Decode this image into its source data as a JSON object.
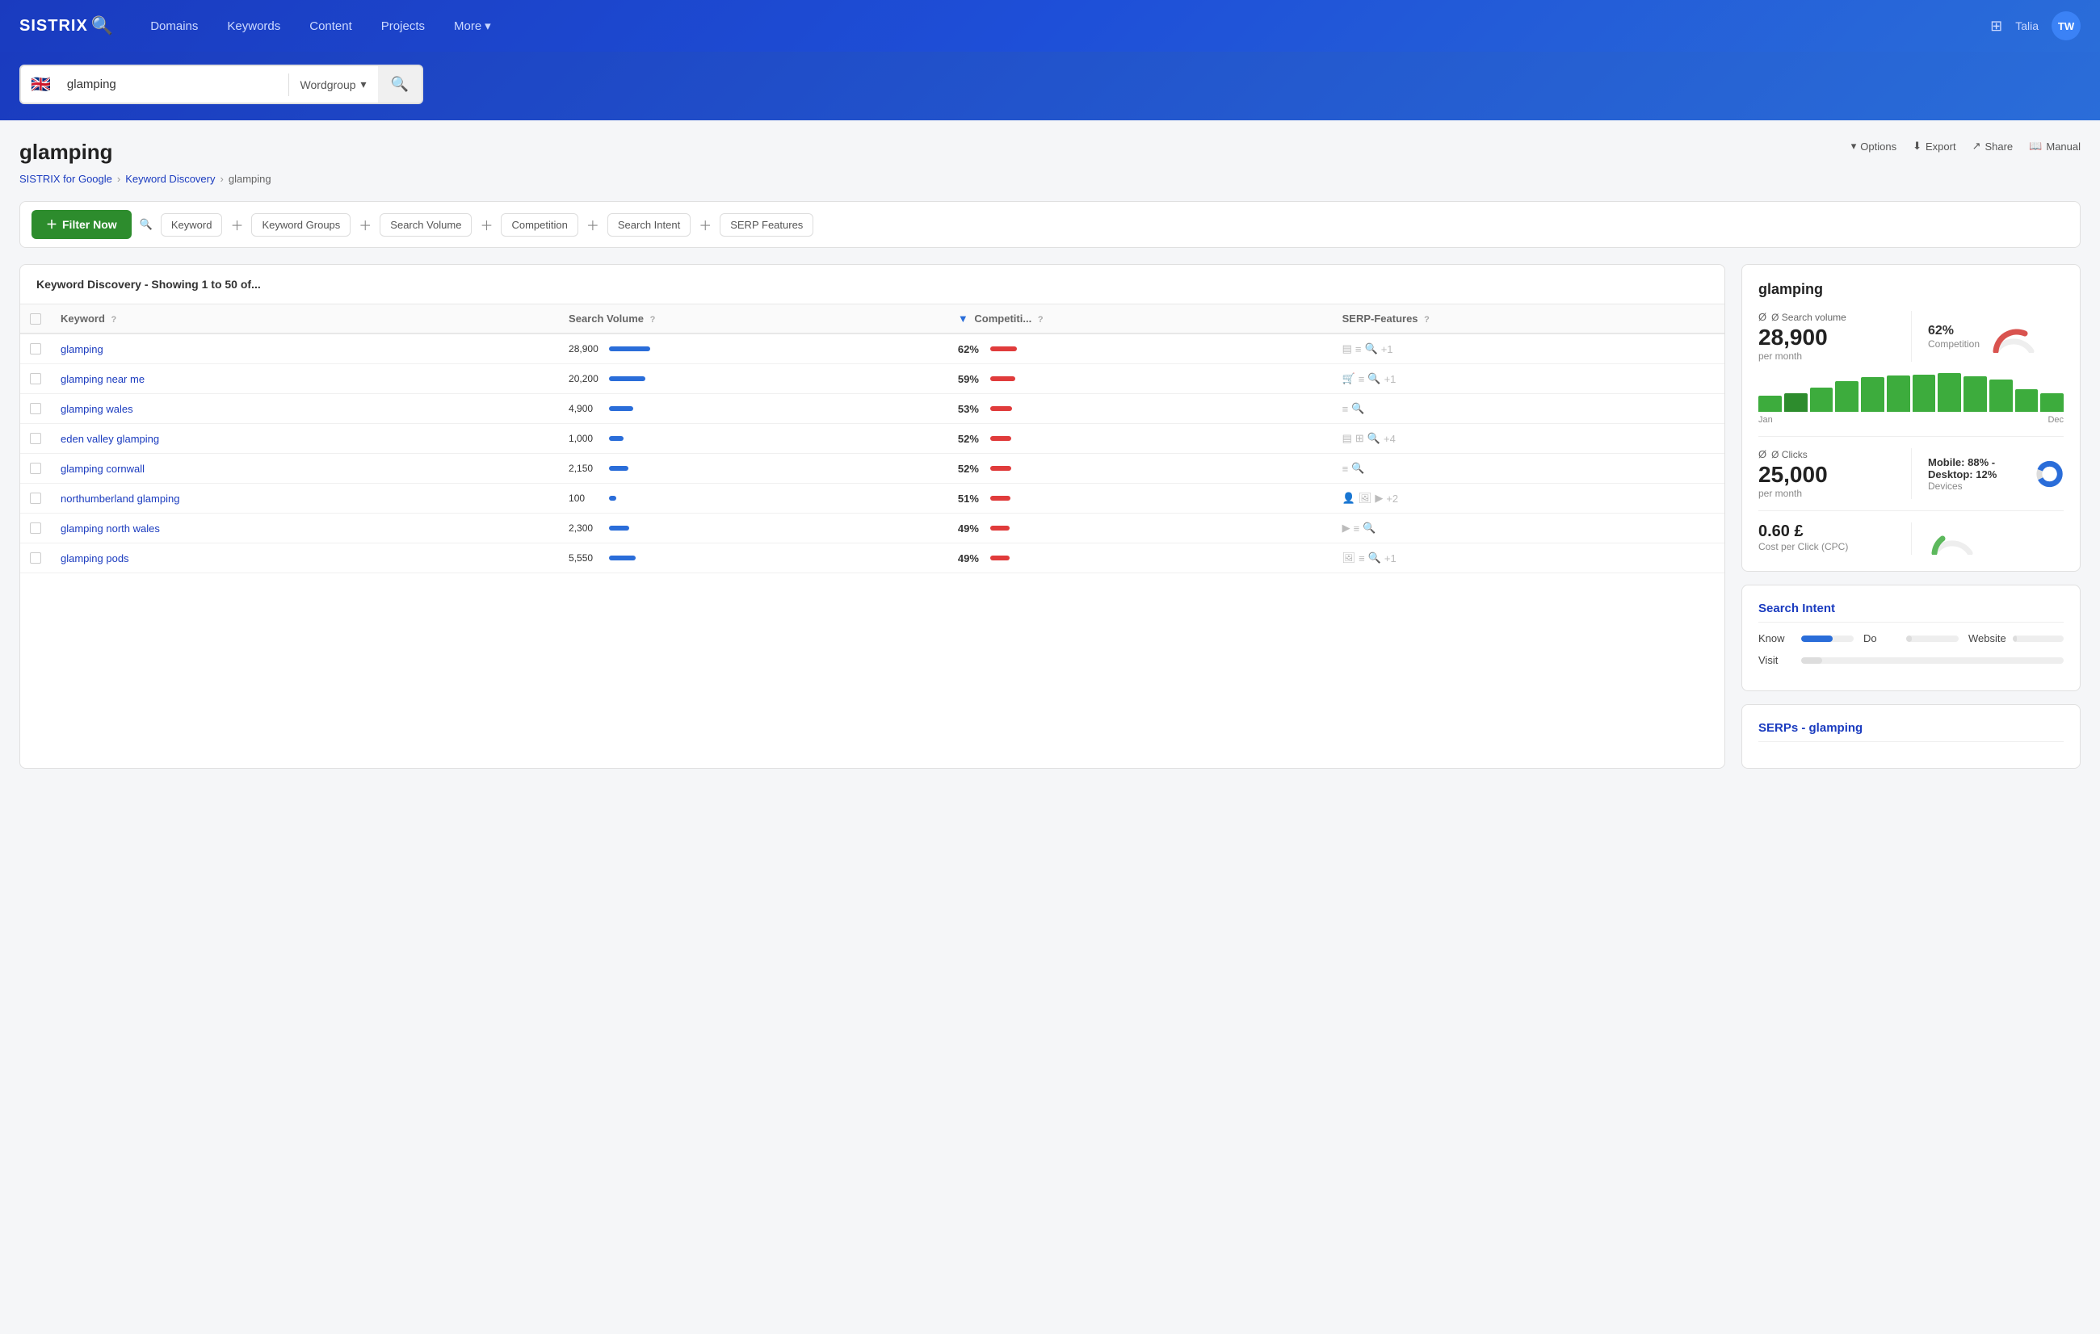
{
  "brand": {
    "name": "SISTRIX",
    "icon": "🔍"
  },
  "navbar": {
    "links": [
      "Domains",
      "Keywords",
      "Content",
      "Projects"
    ],
    "more": "More",
    "user_name": "Talia",
    "user_initials": "TW"
  },
  "search": {
    "query": "glamping",
    "filter": "Wordgroup",
    "flag": "🇬🇧",
    "placeholder": "glamping"
  },
  "page": {
    "title": "glamping",
    "breadcrumb_root": "SISTRIX for Google",
    "breadcrumb_mid": "Keyword Discovery",
    "breadcrumb_current": "glamping",
    "actions": [
      "Options",
      "Export",
      "Share",
      "Manual"
    ]
  },
  "filters": {
    "filter_btn": "Filter Now",
    "items": [
      "Keyword",
      "Keyword Groups",
      "Search Volume",
      "Competition",
      "Search Intent",
      "SERP Features"
    ]
  },
  "table": {
    "header": "Keyword Discovery - Showing 1 to 50 of...",
    "columns": [
      "Keyword",
      "Search Volume",
      "Competiti...",
      "SERP-Features"
    ],
    "rows": [
      {
        "keyword": "glamping",
        "volume": 28900,
        "vol_bar": 85,
        "competition": 62,
        "comp_bar": 60,
        "serp": [
          "▤",
          "≡",
          "🔍",
          "+1"
        ]
      },
      {
        "keyword": "glamping near me",
        "volume": 20200,
        "vol_bar": 75,
        "competition": 59,
        "comp_bar": 57,
        "serp": [
          "🛒",
          "≡",
          "🔍",
          "+1"
        ]
      },
      {
        "keyword": "glamping wales",
        "volume": 4900,
        "vol_bar": 50,
        "competition": 53,
        "comp_bar": 50,
        "serp": [
          "≡",
          "🔍"
        ]
      },
      {
        "keyword": "eden valley glamping",
        "volume": 1000,
        "vol_bar": 30,
        "competition": 52,
        "comp_bar": 48,
        "serp": [
          "▤",
          "⊞",
          "🔍",
          "+4"
        ]
      },
      {
        "keyword": "glamping cornwall",
        "volume": 2150,
        "vol_bar": 40,
        "competition": 52,
        "comp_bar": 48,
        "serp": [
          "≡",
          "🔍"
        ]
      },
      {
        "keyword": "northumberland glamping",
        "volume": 100,
        "vol_bar": 15,
        "competition": 51,
        "comp_bar": 46,
        "serp": [
          "👤",
          "🖼",
          "▶",
          "+2"
        ]
      },
      {
        "keyword": "glamping north wales",
        "volume": 2300,
        "vol_bar": 42,
        "competition": 49,
        "comp_bar": 44,
        "serp": [
          "▶",
          "≡",
          "🔍"
        ]
      },
      {
        "keyword": "glamping pods",
        "volume": 5550,
        "vol_bar": 55,
        "competition": 49,
        "comp_bar": 44,
        "serp": [
          "🖼",
          "≡",
          "🔍",
          "+1"
        ]
      }
    ]
  },
  "sidebar": {
    "title": "glamping",
    "search_volume_label": "Ø Search volume",
    "search_volume_sub": "per month",
    "search_volume_value": "28,900",
    "competition_pct": "62%",
    "competition_label": "Competition",
    "clicks_label": "Ø Clicks",
    "clicks_sub": "per month",
    "clicks_value": "25,000",
    "device_label": "Mobile: 88% - Desktop: 12%",
    "device_sub": "Devices",
    "cpc_value": "0.60 £",
    "cpc_label": "Cost per Click (CPC)",
    "chart_labels": {
      "start": "Jan",
      "end": "Dec"
    },
    "chart_bars": [
      40,
      45,
      60,
      75,
      85,
      90,
      92,
      95,
      88,
      80,
      55,
      45
    ],
    "chart_needle_idx": 1,
    "search_intent_title": "Search Intent",
    "intent": [
      {
        "label": "Know",
        "fill": 60,
        "color": "#2a6dd9"
      },
      {
        "label": "Do",
        "fill": 10,
        "color": "#ddd"
      },
      {
        "label": "Website",
        "fill": 8,
        "color": "#ddd"
      },
      {
        "label": "Visit",
        "fill": 8,
        "color": "#ddd"
      }
    ],
    "serps_title": "SERPs - glamping"
  }
}
